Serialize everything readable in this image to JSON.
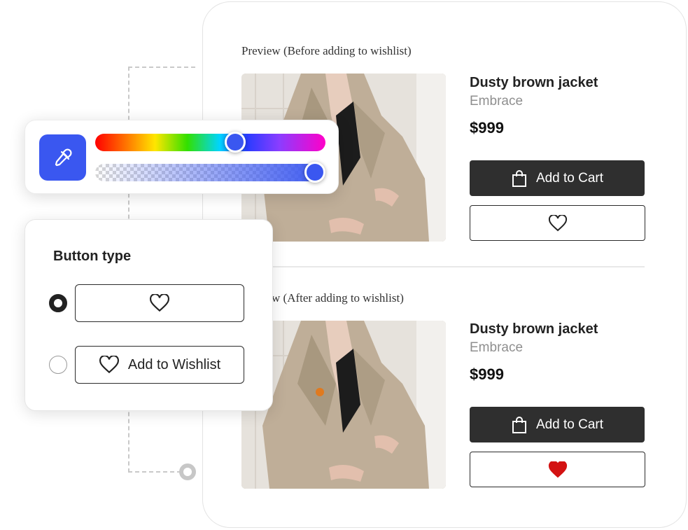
{
  "preview_before": {
    "section_label": "Preview (Before adding to wishlist)",
    "product": {
      "title": "Dusty brown jacket",
      "brand": "Embrace",
      "price": "$999",
      "cart_label": "Add to Cart",
      "wishlist_state": "empty"
    }
  },
  "preview_after": {
    "section_label": "w (After adding to wishlist)",
    "product": {
      "title": "Dusty brown jacket",
      "brand": "Embrace",
      "price": "$999",
      "cart_label": "Add to Cart",
      "wishlist_state": "filled"
    }
  },
  "color_picker": {
    "icon": "eyedropper-icon",
    "hue_level": 0.62,
    "alpha_level": 1.0,
    "selected_color": "#3a57f0"
  },
  "button_type": {
    "title": "Button type",
    "options": [
      {
        "label": "",
        "icon": "heart-outline-icon",
        "selected": true
      },
      {
        "label": "Add to Wishlist",
        "icon": "heart-outline-icon",
        "selected": false
      }
    ]
  },
  "colors": {
    "accent": "#3a57f0",
    "cart_button": "#2f2f2f",
    "wishlist_active": "#d31212"
  }
}
